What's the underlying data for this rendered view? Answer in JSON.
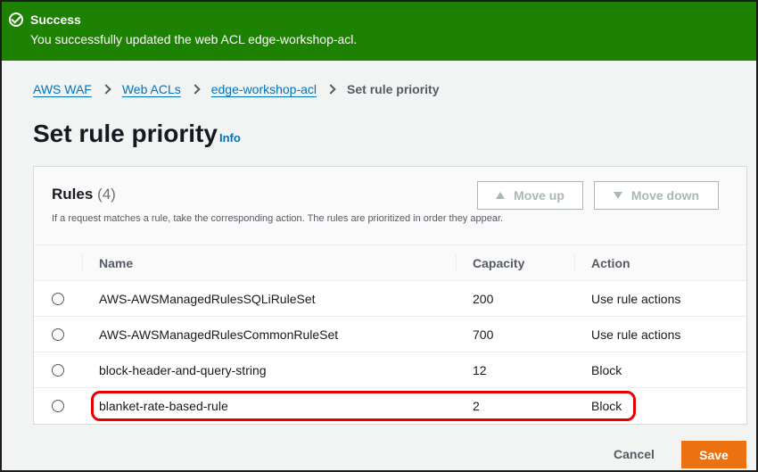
{
  "flash": {
    "title": "Success",
    "message": "You successfully updated the web ACL edge-workshop-acl.",
    "icon": "check-circle-icon"
  },
  "breadcrumbs": [
    {
      "label": "AWS WAF"
    },
    {
      "label": "Web ACLs"
    },
    {
      "label": "edge-workshop-acl"
    },
    {
      "label": "Set rule priority"
    }
  ],
  "page": {
    "title": "Set rule priority",
    "info_label": "Info"
  },
  "rules_panel": {
    "title": "Rules",
    "count": "(4)",
    "description": "If a request matches a rule, take the corresponding action. The rules are prioritized in order they appear.",
    "move_up_label": "Move up",
    "move_down_label": "Move down",
    "columns": {
      "name": "Name",
      "capacity": "Capacity",
      "action": "Action"
    },
    "rows": [
      {
        "name": "AWS-AWSManagedRulesSQLiRuleSet",
        "capacity": "200",
        "action": "Use rule actions",
        "selected": false
      },
      {
        "name": "AWS-AWSManagedRulesCommonRuleSet",
        "capacity": "700",
        "action": "Use rule actions",
        "selected": false
      },
      {
        "name": "block-header-and-query-string",
        "capacity": "12",
        "action": "Block",
        "selected": false
      },
      {
        "name": "blanket-rate-based-rule",
        "capacity": "2",
        "action": "Block",
        "selected": false
      }
    ]
  },
  "footer": {
    "cancel_label": "Cancel",
    "save_label": "Save"
  },
  "colors": {
    "success_green": "#1d8102",
    "link_blue": "#0073bb",
    "primary_orange": "#ec7211",
    "highlight_red": "#e80000"
  }
}
